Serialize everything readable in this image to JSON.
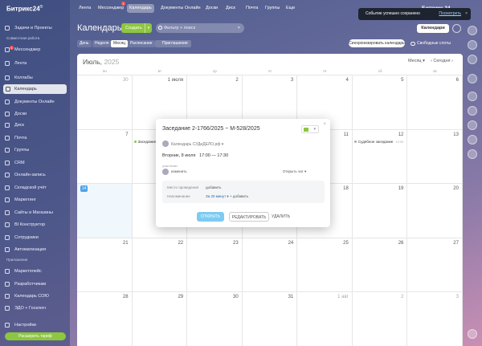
{
  "sidebar": {
    "logo": "Битрикс24",
    "logo_mark": "®",
    "top_items": [
      {
        "label": "Задачи и Проекты"
      }
    ],
    "group1": "Совместная работа",
    "items": [
      {
        "label": "Мессенджер",
        "badge": "1"
      },
      {
        "label": "Лента"
      },
      {
        "label": "Коллабы"
      },
      {
        "label": "Календарь",
        "active": true
      },
      {
        "label": "Документы Онлайн"
      },
      {
        "label": "Доски"
      },
      {
        "label": "Диск"
      },
      {
        "label": "Почта"
      },
      {
        "label": "Группы"
      },
      {
        "label": "CRM"
      },
      {
        "label": "Онлайн-запись"
      },
      {
        "label": "Складской учёт"
      },
      {
        "label": "Маркетинг"
      },
      {
        "label": "Сайты и Магазины"
      },
      {
        "label": "BI Конструктор"
      },
      {
        "label": "Сотрудники"
      },
      {
        "label": "Автоматизация"
      }
    ],
    "group2": "Приложения",
    "items2": [
      {
        "label": "Маркетплейс"
      },
      {
        "label": "Разработчикам"
      },
      {
        "label": "Календарь СОЮ"
      },
      {
        "label": "ЭДО + Госключ"
      }
    ],
    "settings": "Настройки",
    "upgrade": "Расширить тариф"
  },
  "topnav": {
    "items": [
      {
        "label": "Лента"
      },
      {
        "label": "Мессенджер",
        "badge": "1"
      },
      {
        "label": "Календарь",
        "active": true
      },
      {
        "label": "Документы Онлайн"
      },
      {
        "label": "Доски"
      },
      {
        "label": "Диск"
      },
      {
        "label": "Почта"
      },
      {
        "label": "Группы"
      },
      {
        "label": "Еще"
      }
    ],
    "brand": "Битрикс 24"
  },
  "toast": {
    "text": "Событие успешно сохранено",
    "link": "Посмотреть",
    "close": "×"
  },
  "header": {
    "title": "Календарь",
    "create": "Создать",
    "filter_placeholder": "Фильтр + поиск",
    "filter_clear": "×",
    "calendars": "Календари"
  },
  "views": {
    "tabs": [
      {
        "label": "День"
      },
      {
        "label": "Неделя"
      },
      {
        "label": "Месяц",
        "active": true
      },
      {
        "label": "Расписание"
      }
    ],
    "invitations": "Приглашения",
    "sync": "Синхронизировать календарь",
    "free_slots": "Свободные слоты"
  },
  "calendar": {
    "month": "Июль,",
    "year": "2025",
    "period": "Месяц",
    "today": "Сегодня",
    "weekdays": [
      "пн",
      "вт",
      "ср",
      "чт",
      "пт",
      "сб",
      "вс"
    ],
    "weeks": [
      [
        "30",
        "1 июля",
        "2",
        "3",
        "4",
        "5",
        "6"
      ],
      [
        "7",
        "8",
        "9",
        "10",
        "11",
        "12",
        "13"
      ],
      [
        "14",
        "15",
        "16",
        "17",
        "18",
        "19",
        "20"
      ],
      [
        "21",
        "22",
        "23",
        "24",
        "25",
        "26",
        "27"
      ],
      [
        "28",
        "29",
        "30",
        "31",
        "1 авг",
        "2",
        "3"
      ]
    ],
    "today_label": "14",
    "week2_sat_sub": "12:00",
    "events": [
      {
        "label": "Заседание 2",
        "color": "#8dc63f"
      },
      {
        "label": "Судебное заседание",
        "color": "#aaaaaa"
      }
    ]
  },
  "popup": {
    "title": "Заседание 2-1766/2025 ~ М-528/2025",
    "calendar": "Календарь СУДиДЕЛО.рф",
    "date": "Вторник, 8 июля",
    "start": "17:00",
    "sep": "—",
    "end": "17:30",
    "participants_label": "участники",
    "change": "изменить",
    "open_chat": "Открыть чат",
    "location_label": "Место проведения",
    "location_value": "добавить",
    "reminder_label": "Напоминание",
    "reminder_value": "За 20 минут",
    "reminder_add": "добавить",
    "btn_open": "ОТКРЫТЬ",
    "btn_edit": "РЕДАКТИРОВАТЬ",
    "btn_delete": "УДАЛИТЬ",
    "close": "×"
  }
}
